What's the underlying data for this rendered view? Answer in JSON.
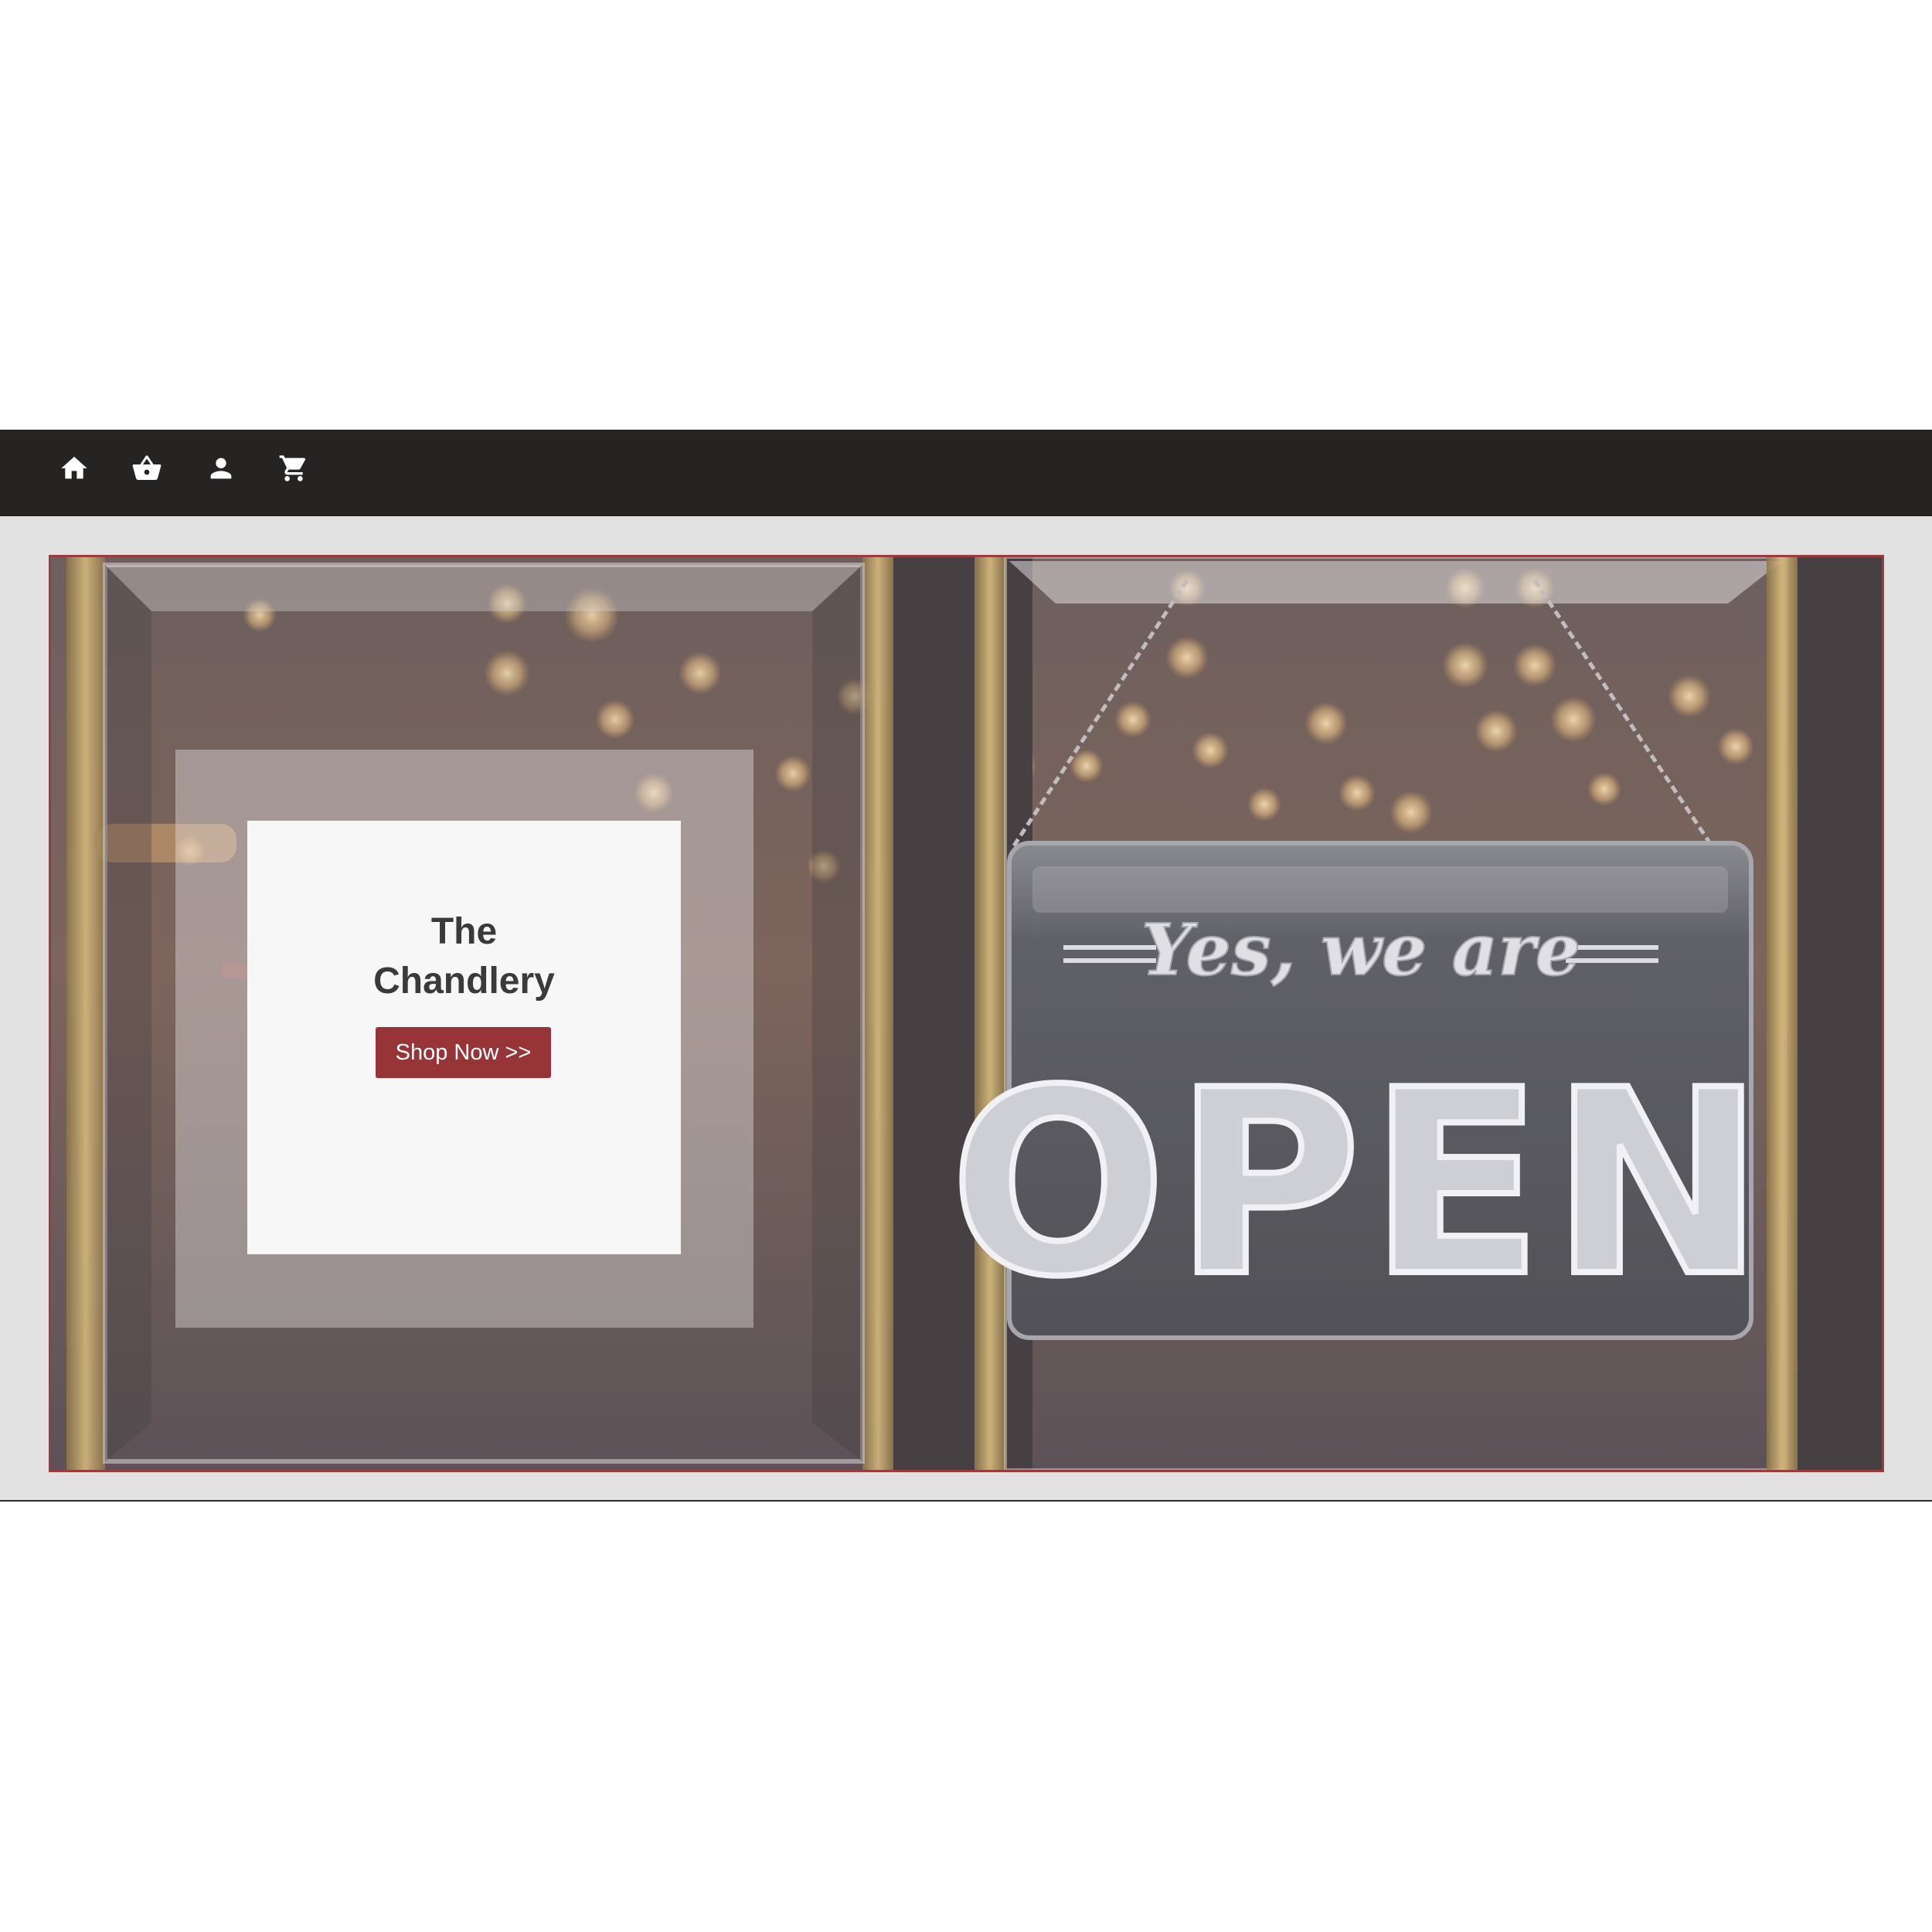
{
  "nav": {
    "icons": [
      {
        "name": "home-icon"
      },
      {
        "name": "basket-icon"
      },
      {
        "name": "user-icon"
      },
      {
        "name": "cart-icon"
      }
    ]
  },
  "hero": {
    "title": "The\nChandlery",
    "button_label": "Shop Now >>",
    "sign_script": "Yes, we are",
    "sign_word": "OPEN"
  },
  "colors": {
    "navbar": "#262323",
    "accent": "#973438",
    "band": "#e3e2e2",
    "card": "#f7f7f8"
  }
}
